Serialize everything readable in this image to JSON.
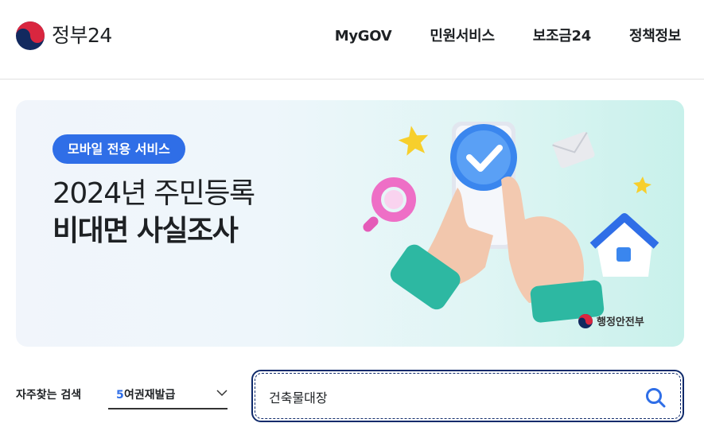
{
  "header": {
    "logo_text": "정부24",
    "nav": [
      "MyGOV",
      "민원서비스",
      "보조금24",
      "정책정보"
    ]
  },
  "banner": {
    "badge": "모바일 전용 서비스",
    "title_line1": "2024년 주민등록",
    "title_line2": "비대면 사실조사",
    "ministry": "행정안전부"
  },
  "search": {
    "frequent_label": "자주찾는 검색",
    "frequent_rank": "5",
    "frequent_term": "여권재발급",
    "query": "건축물대장"
  },
  "colors": {
    "brand_blue": "#2f6ee7",
    "search_border": "#0f2a6b",
    "text": "#1e2124"
  }
}
